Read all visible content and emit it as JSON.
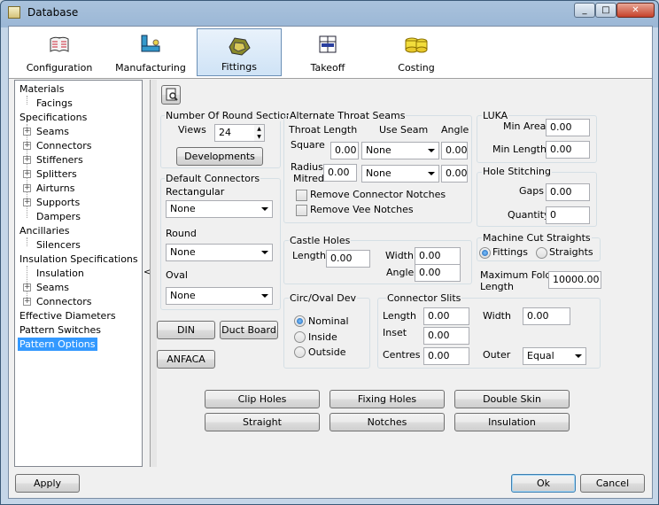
{
  "window": {
    "title": "Database",
    "minimize": "_",
    "maximize": "□",
    "close": "✕"
  },
  "tabs": [
    {
      "label": "Configuration",
      "icon": "configuration-icon"
    },
    {
      "label": "Manufacturing",
      "icon": "manufacturing-icon"
    },
    {
      "label": "Fittings",
      "icon": "fittings-icon",
      "active": true
    },
    {
      "label": "Takeoff",
      "icon": "takeoff-icon"
    },
    {
      "label": "Costing",
      "icon": "costing-icon"
    }
  ],
  "tree": [
    "Materials",
    "Facings",
    "Specifications",
    "Seams",
    "Connectors",
    "Stiffeners",
    "Splitters",
    "Airturns",
    "Supports",
    "Dampers",
    "Ancillaries",
    "Silencers",
    "Insulation Specifications",
    "Insulation",
    "Seams",
    "Connectors",
    "Effective Diameters",
    "Pattern Switches",
    "Pattern Options"
  ],
  "splitter": "<",
  "round_sections": {
    "title": "Number Of Round Sections",
    "views_label": "Views",
    "views_value": "24",
    "developments": "Developments"
  },
  "default_connectors": {
    "title": "Default Connectors",
    "rectangular_label": "Rectangular",
    "rectangular_value": "None",
    "round_label": "Round",
    "round_value": "None",
    "oval_label": "Oval",
    "oval_value": "None"
  },
  "left_buttons": {
    "din": "DIN",
    "duct_board": "Duct Board",
    "anfaca": "ANFACA"
  },
  "throat_seams": {
    "title": "Alternate Throat Seams",
    "throat_length": "Throat Length",
    "use_seam": "Use Seam",
    "angle": "Angle",
    "square": "Square",
    "square_len": "0.00",
    "square_seam": "None",
    "square_angle": "0.00",
    "radius": "Radius",
    "mitred": "Mitred",
    "radius_len": "0.00",
    "radius_seam": "None",
    "radius_angle": "0.00",
    "remove_connector": "Remove Connector Notches",
    "remove_vee": "Remove Vee Notches"
  },
  "castle_holes": {
    "title": "Castle Holes",
    "length_label": "Length",
    "length": "0.00",
    "width_label": "Width",
    "width": "0.00",
    "angle_label": "Angle",
    "angle": "0.00"
  },
  "circ_oval": {
    "title": "Circ/Oval Dev",
    "nominal": "Nominal",
    "inside": "Inside",
    "outside": "Outside"
  },
  "connector_slits": {
    "title": "Connector Slits",
    "length_label": "Length",
    "length": "0.00",
    "width_label": "Width",
    "width": "0.00",
    "inset_label": "Inset",
    "inset": "0.00",
    "centres_label": "Centres",
    "centres": "0.00",
    "outer_label": "Outer",
    "outer": "Equal"
  },
  "luka": {
    "title": "LUKA",
    "min_area_label": "Min Area",
    "min_area": "0.00",
    "min_length_label": "Min Length",
    "min_length": "0.00"
  },
  "hole_stitching": {
    "title": "Hole Stitching",
    "gaps_label": "Gaps",
    "gaps": "0.00",
    "quantity_label": "Quantity",
    "quantity": "0"
  },
  "machine_cut": {
    "title": "Machine Cut Straights",
    "fittings": "Fittings",
    "straights": "Straights"
  },
  "max_fold": {
    "label1": "Maximum Fold",
    "label2": "Length",
    "value": "10000.00"
  },
  "bottom_buttons": [
    "Clip Holes",
    "Fixing Holes",
    "Double Skin",
    "Straight",
    "Notches",
    "Insulation"
  ],
  "footer": {
    "apply": "Apply",
    "ok": "Ok",
    "cancel": "Cancel"
  }
}
